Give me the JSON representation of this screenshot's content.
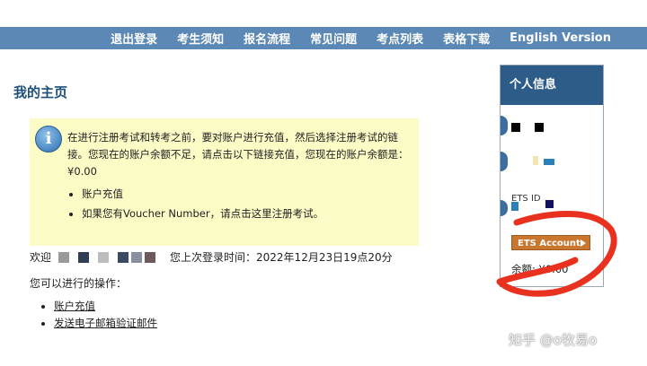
{
  "topnav": {
    "items": [
      "退出登录",
      "考生须知",
      "报名流程",
      "常见问题",
      "考点列表",
      "表格下载",
      "English Version"
    ]
  },
  "main": {
    "title": "我的主页",
    "notice": {
      "text": "在进行注册考试和转考之前，要对账户进行充值，然后选择注册考试的链接。您现在的账户余额不足，请点击以下链接充值，您现在的账户余额是：¥0.00",
      "items": [
        {
          "label": "账户充值"
        },
        {
          "prefix": "如果您有Voucher Number，请点击",
          "link": "这里",
          "suffix": "注册考试。"
        }
      ]
    },
    "welcome": {
      "prefix": "欢迎",
      "suffix": "您上次登录时间：2022年12月23日19点20分"
    },
    "ops_label": "您可以进行的操作：",
    "ops": [
      "账户充值",
      "发送电子邮箱验证邮件"
    ]
  },
  "sidebar": {
    "title": "个人信息",
    "ets_label": "ETS ID",
    "ets_button": "ETS Account",
    "balance": "余额: ¥0.00"
  },
  "watermark": "知乎 @o牧易o",
  "colors": {
    "nav_bg": "#5b88b4",
    "title": "#1d4f7a",
    "notice_bg": "#fbfbc6",
    "sidebar_header": "#2d5c89",
    "ets_button": "#c9772f",
    "annotation": "#e8321f"
  }
}
